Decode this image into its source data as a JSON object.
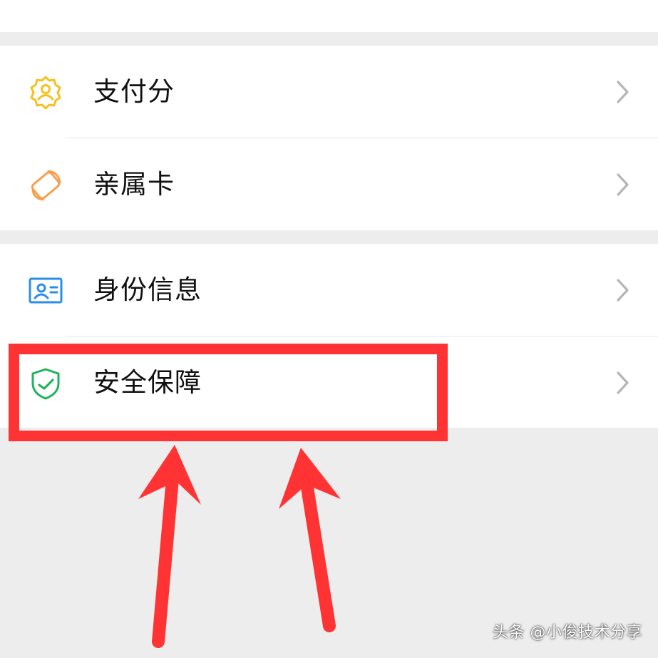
{
  "sections": [
    {
      "items": [
        {
          "label": "支付分",
          "icon": "payment-score-badge-icon",
          "color": "#f5c21b"
        },
        {
          "label": "亲属卡",
          "icon": "family-card-icon",
          "color": "#f6a04d"
        }
      ]
    },
    {
      "items": [
        {
          "label": "身份信息",
          "icon": "id-card-icon",
          "color": "#2a8ee8"
        },
        {
          "label": "安全保障",
          "icon": "security-shield-icon",
          "color": "#1fb35a"
        }
      ]
    }
  ],
  "annotation": {
    "highlight_color": "#ff3333",
    "highlighted_item": "安全保障"
  },
  "watermark": "头条 @小俊技术分享"
}
